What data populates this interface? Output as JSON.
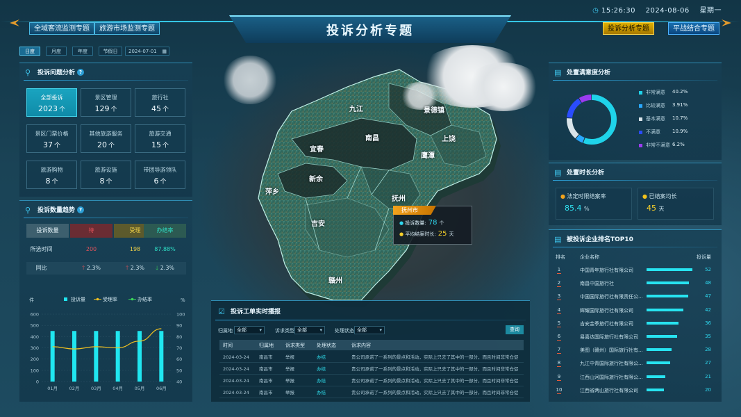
{
  "header": {
    "title": "投诉分析专题",
    "time": "15:26:30",
    "date": "2024-08-06",
    "weekday": "星期一",
    "nav_left": [
      "全域客流监测专题",
      "旅游市场监测专题"
    ],
    "nav_right": [
      "投诉分析专题",
      "平战结合专题"
    ]
  },
  "filters": {
    "tabs": [
      "日度",
      "月度",
      "年度",
      "节假日"
    ],
    "date_value": "2024-07-01",
    "calendar_icon": "calendar-icon"
  },
  "complaint_issues": {
    "title": "投诉问题分析",
    "help": "?",
    "unit": "个",
    "cards": [
      {
        "label": "全部投诉",
        "value": "2023"
      },
      {
        "label": "景区管理",
        "value": "129"
      },
      {
        "label": "旅行社",
        "value": "45"
      },
      {
        "label": "景区门票价格",
        "value": "37"
      },
      {
        "label": "其他旅游服务",
        "value": "20"
      },
      {
        "label": "旅游交通",
        "value": "15"
      },
      {
        "label": "旅游购物",
        "value": "8"
      },
      {
        "label": "旅游设施",
        "value": "8"
      },
      {
        "label": "带团导游领队",
        "value": "6"
      }
    ]
  },
  "complaint_trend": {
    "title": "投诉数量趋势",
    "help": "?",
    "headers": [
      "投诉数量",
      "待",
      "受理",
      "办结率"
    ],
    "rows": [
      {
        "label": "所选时间",
        "values": [
          "200",
          "198",
          "87.88%"
        ]
      },
      {
        "label": "同比",
        "values": [
          "2.3%",
          "2.3%",
          "2.3%"
        ],
        "arrows": [
          "up",
          "up",
          "down"
        ]
      }
    ]
  },
  "chart_data": {
    "type": "bar",
    "categories": [
      "01月",
      "02月",
      "03月",
      "04月",
      "05月",
      "06月"
    ],
    "series": [
      {
        "name": "投诉量",
        "type": "bar",
        "axis": "left",
        "values": [
          450,
          450,
          450,
          450,
          450,
          450
        ],
        "color": "#20e6f0"
      },
      {
        "name": "受理率",
        "type": "line",
        "axis": "right",
        "values": [
          71,
          69,
          71,
          70,
          76,
          87
        ],
        "color": "#f0c020"
      },
      {
        "name": "办结率",
        "type": "line",
        "axis": "right",
        "values": [],
        "color": "#3ad45a"
      }
    ],
    "ylabel_left": "件",
    "ylabel_right": "%",
    "ylim_left": [
      0,
      600
    ],
    "yticks_left": [
      0,
      100,
      200,
      300,
      400,
      500,
      600
    ],
    "ylim_right": [
      40,
      100
    ],
    "yticks_right": [
      40,
      50,
      60,
      70,
      80,
      90,
      100
    ],
    "grid": true,
    "legend_position": "top"
  },
  "map": {
    "labels": [
      "九江",
      "景德镇",
      "南昌",
      "上饶",
      "宜春",
      "鹰潭",
      "新余",
      "萍乡",
      "抚州",
      "吉安",
      "赣州"
    ],
    "popup": {
      "city": "抚州市",
      "count_label": "投诉数量:",
      "count_value": "78",
      "count_unit": "个",
      "avg_label": "平均结案时长:",
      "avg_value": "25",
      "avg_unit": "天"
    }
  },
  "realtime": {
    "title": "投诉工单实时播报",
    "filters": [
      {
        "label": "归属地",
        "value": "全部"
      },
      {
        "label": "诉求类型",
        "value": "全部"
      },
      {
        "label": "处理状态",
        "value": "全部"
      }
    ],
    "query_button": "查询",
    "columns": [
      "时间",
      "归属地",
      "诉求类型",
      "处理状态",
      "诉求内容"
    ],
    "rows": [
      [
        "2024-03-24",
        "南昌市",
        "举报",
        "办结",
        "贵公司承诺了一系列的景点和活动，实际上只去了其中的一部分，而且时间非常仓促..."
      ],
      [
        "2024-03-24",
        "南昌市",
        "举报",
        "办结",
        "贵公司承诺了一系列的景点和活动，实际上只去了其中的一部分，而且时间非常仓促..."
      ],
      [
        "2024-03-24",
        "南昌市",
        "举报",
        "办结",
        "贵公司承诺了一系列的景点和活动，实际上只去了其中的一部分，而且时间非常仓促..."
      ],
      [
        "2024-03-24",
        "南昌市",
        "举报",
        "办结",
        "贵公司承诺了一系列的景点和活动，实际上只去了其中的一部分，而且时间非常仓促..."
      ]
    ]
  },
  "satisfaction": {
    "title": "处置满意度分析",
    "items": [
      {
        "label": "非常满意",
        "pct": "40.2%",
        "value": 40.2,
        "color": "#1fd3ea"
      },
      {
        "label": "比较满意",
        "pct": "3.91%",
        "value": 3.91,
        "color": "#2aa8ff"
      },
      {
        "label": "基本满意",
        "pct": "10.7%",
        "value": 10.7,
        "color": "#d9e4ea"
      },
      {
        "label": "不满意",
        "pct": "10.9%",
        "value": 10.9,
        "color": "#2a4cff"
      },
      {
        "label": "非常不满意",
        "pct": "6.2%",
        "value": 6.2,
        "color": "#9a3cf0"
      }
    ]
  },
  "duration": {
    "title": "处置时长分析",
    "items": [
      {
        "label": "法定时限结案率",
        "value": "85.4",
        "unit": "%",
        "color": "#f2a31c",
        "value_color": "#2fe0ef"
      },
      {
        "label": "已结案均长",
        "value": "45",
        "unit": "天",
        "color": "#f2c21c",
        "value_color": "#f5cf2a"
      }
    ]
  },
  "ranking": {
    "title": "被投诉企业排名TOP10",
    "columns": [
      "排名",
      "企业名称",
      "投诉量"
    ],
    "max": 52,
    "rows": [
      {
        "rank": "1",
        "name": "中国青年旅行社有限公司",
        "value": 52
      },
      {
        "rank": "2",
        "name": "南昌中国旅行社",
        "value": 48
      },
      {
        "rank": "3",
        "name": "中国国际旅行社有限责任公...",
        "value": 47
      },
      {
        "rank": "4",
        "name": "辉耀国际旅行社有限公司",
        "value": 42
      },
      {
        "rank": "5",
        "name": "吉安金季旅行社有限公司",
        "value": 36
      },
      {
        "rank": "6",
        "name": "易喜达国际旅行社有限公司",
        "value": 35
      },
      {
        "rank": "7",
        "name": "美图（赣州）国际旅行社有...",
        "value": 28
      },
      {
        "rank": "8",
        "name": "九江中青国际旅行社有限公...",
        "value": 27
      },
      {
        "rank": "9",
        "name": "江西山河国际旅行社有限公...",
        "value": 21
      },
      {
        "rank": "10",
        "name": "江西省两山旅行社有限公司",
        "value": 20
      }
    ]
  }
}
